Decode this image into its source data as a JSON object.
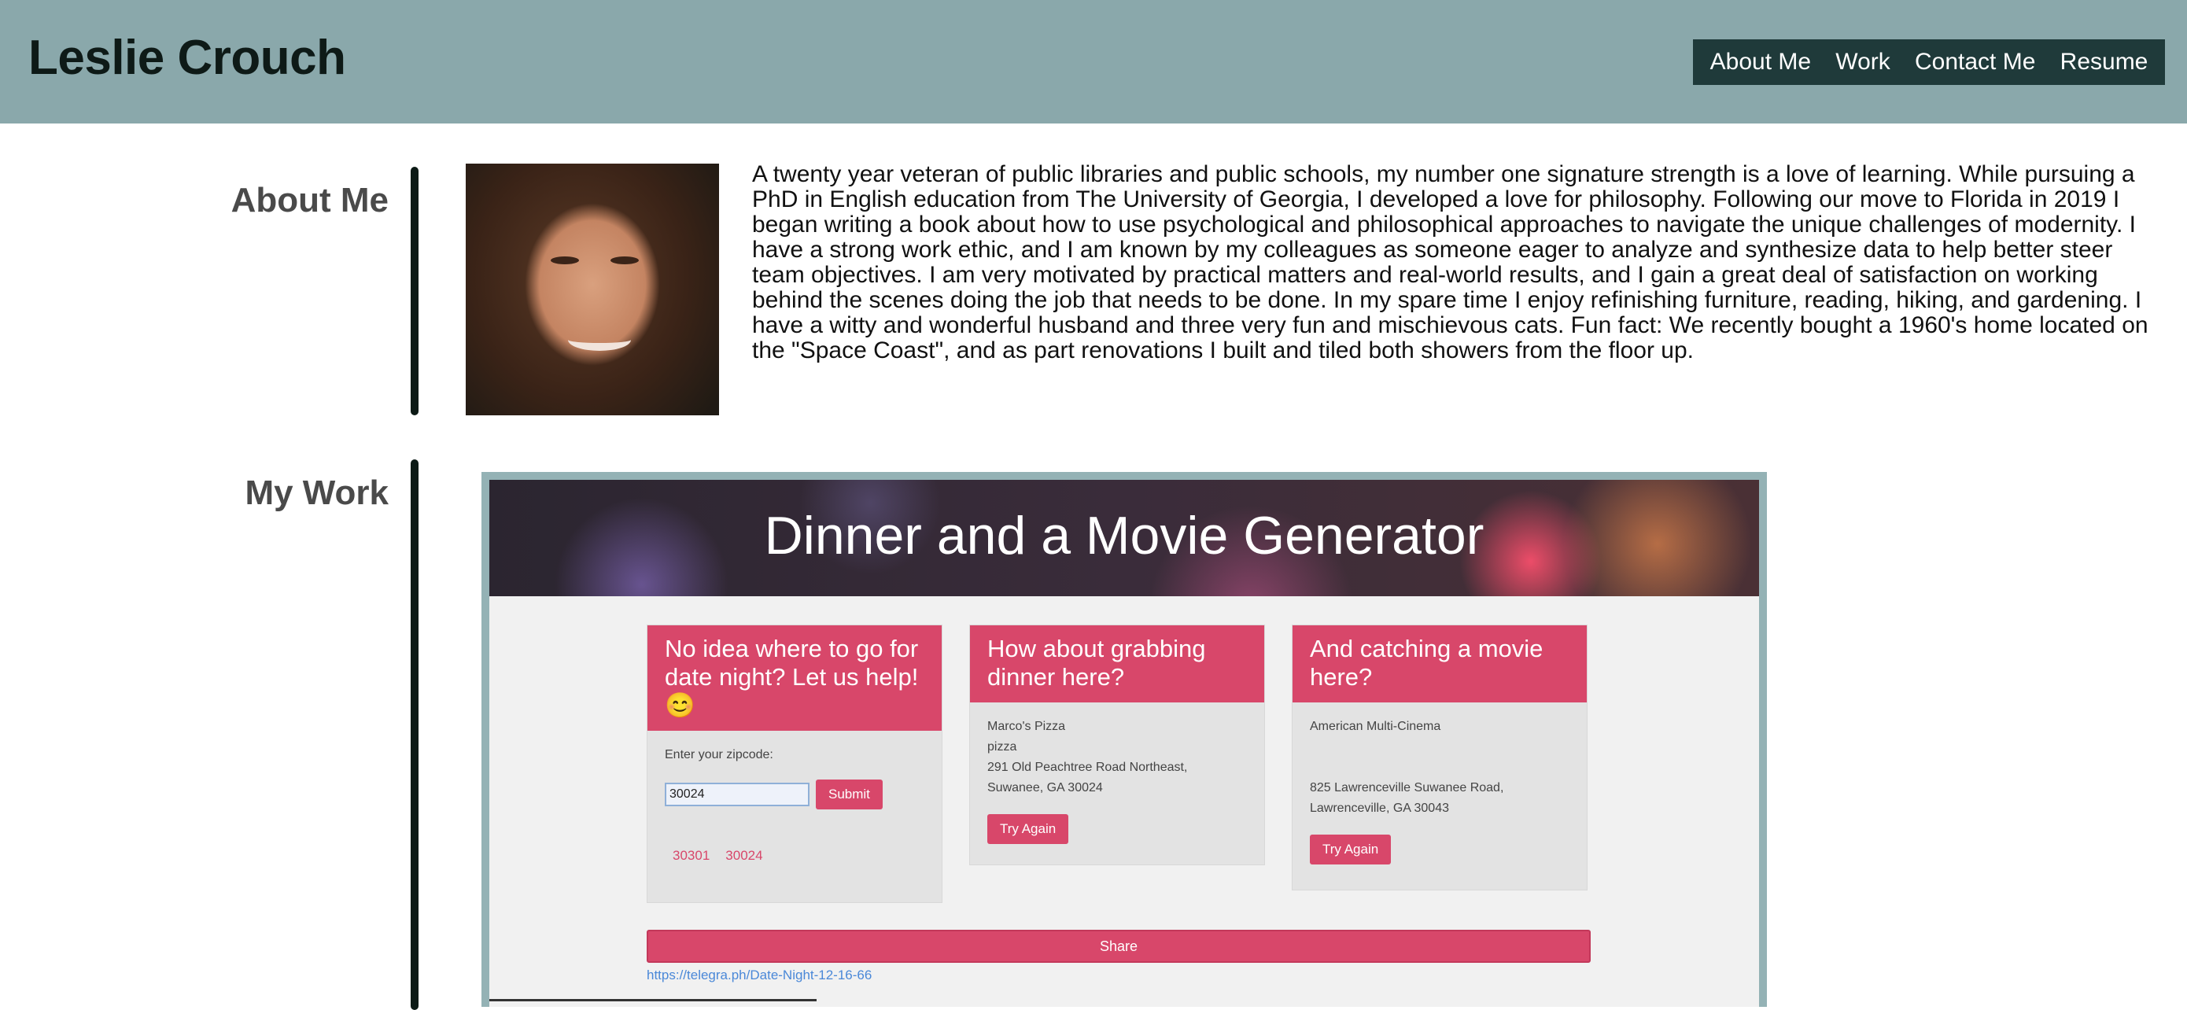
{
  "header": {
    "site_title": "Leslie Crouch",
    "nav": [
      "About Me",
      "Work",
      "Contact Me",
      "Resume"
    ]
  },
  "about": {
    "heading": "About Me",
    "photo_alt": "Profile photo",
    "text": "A twenty year veteran of public libraries and public schools, my number one signature strength is a love of learning. While pursuing a PhD in English education from The University of Georgia, I developed a love for philosophy. Following our move to Florida in 2019 I began writing a book about how to use psychological and philosophical approaches to navigate the unique challenges of modernity. I have a strong work ethic, and I am known by my colleagues as someone eager to analyze and synthesize data to help better steer team objectives. I am very motivated by practical matters and real-world results, and I gain a great deal of satisfaction on working behind the scenes doing the job that needs to be done. In my spare time I enjoy refinishing furniture, reading, hiking, and gardening. I have a witty and wonderful husband and three very fun and mischievous cats. Fun fact: We recently bought a 1960's home located on the \"Space Coast\", and as part renovations I built and tiled both showers from the floor up."
  },
  "work": {
    "heading": "My Work",
    "project": {
      "title": "Dinner and a Movie Generator",
      "card1": {
        "heading": "No idea where to go for date night? Let us help! 😊",
        "zip_label": "Enter your zipcode:",
        "zip_value": "30024",
        "submit_label": "Submit",
        "recent_zips": [
          "30301",
          "30024"
        ]
      },
      "card2": {
        "heading": "How about grabbing dinner here?",
        "restaurant_name": "Marco's Pizza",
        "restaurant_type": "pizza",
        "address_line1": "291 Old Peachtree Road Northeast,",
        "address_line2": "Suwanee, GA 30024",
        "try_again_label": "Try Again"
      },
      "card3": {
        "heading": "And catching a movie here?",
        "theater_name": "American Multi-Cinema",
        "address_line1": "825 Lawrenceville Suwanee Road,",
        "address_line2": "Lawrenceville, GA 30043",
        "try_again_label": "Try Again"
      },
      "share_label": "Share",
      "share_link": "https://telegra.ph/Date-Night-12-16-66"
    }
  },
  "colors": {
    "header_bg": "#8aa8ab",
    "nav_bg": "#1f3a3a",
    "accent_pink": "#d8476a",
    "section_bar": "#0c1a16"
  }
}
